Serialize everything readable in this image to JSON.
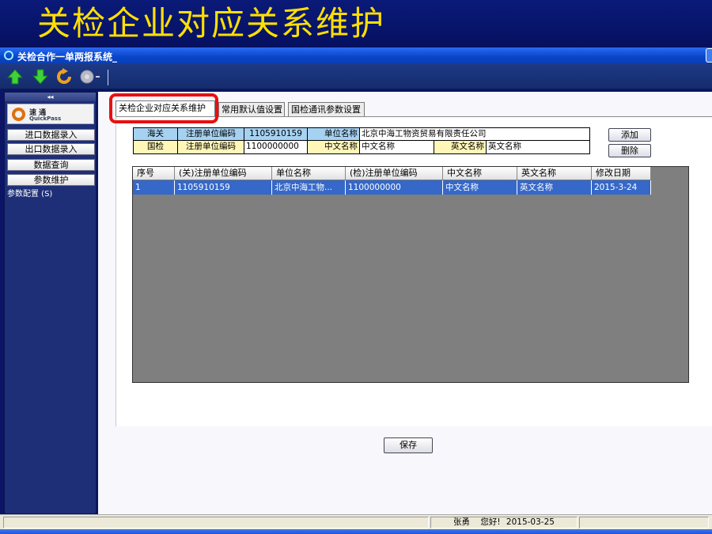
{
  "slide": {
    "title": "关检企业对应关系维护"
  },
  "window": {
    "title": "关检合作一单两报系统_"
  },
  "toolbar": {
    "icons": [
      "arrow-up-icon",
      "arrow-down-icon",
      "refresh-icon",
      "circle-dropdown-icon"
    ]
  },
  "sidebar": {
    "collapse": "◂◂",
    "logo_line1": "速 通",
    "logo_line2": "QuickPass",
    "items": [
      {
        "label": "进口数据录入"
      },
      {
        "label": "出口数据录入"
      },
      {
        "label": "数据查询"
      },
      {
        "label": "参数维护"
      }
    ],
    "sub_item": "参数配置 (S)"
  },
  "tabs": [
    {
      "label": "关检企业对应关系维护",
      "active": true
    },
    {
      "label": "常用默认值设置",
      "active": false
    },
    {
      "label": "国检通讯参数设置",
      "active": false
    }
  ],
  "form": {
    "customs": {
      "label": "海关",
      "code_label": "注册单位编码",
      "code_value": "1105910159",
      "name_label": "单位名称",
      "name_value": "北京中海工物资贸易有限责任公司"
    },
    "inspection": {
      "label": "国检",
      "code_label": "注册单位编码",
      "code_value": "1100000000",
      "cn_label": "中文名称",
      "cn_value": "中文名称",
      "en_label": "英文名称",
      "en_value": "英文名称"
    },
    "add_button": "添加",
    "delete_button": "删除"
  },
  "grid": {
    "columns": [
      "序号",
      "(关)注册单位编码",
      "单位名称",
      "(检)注册单位编码",
      "中文名称",
      "英文名称",
      "修改日期"
    ],
    "rows": [
      [
        "1",
        "1105910159",
        "北京中海工物...",
        "1100000000",
        "中文名称",
        "英文名称",
        "2015-3-24"
      ]
    ]
  },
  "save_button": "保存",
  "status": {
    "user": "张勇",
    "greeting": "您好!",
    "date": "2015-03-25"
  },
  "colors": {
    "slide_title": "#ffe000",
    "selected_row": "#3568c8",
    "highlight_ring": "#e81010",
    "label_blue": "#a6d2f2",
    "label_yellow": "#fff6b8"
  }
}
